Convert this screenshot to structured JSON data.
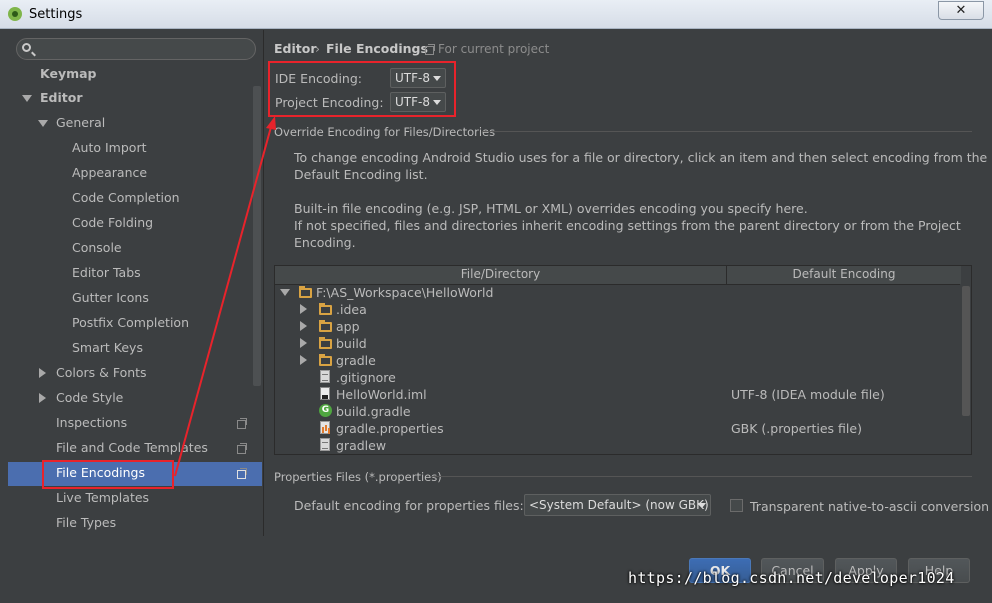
{
  "window": {
    "title": "Settings",
    "close_symbol": "✕"
  },
  "search": {
    "placeholder": ""
  },
  "sidebar": {
    "items": [
      {
        "label": "Keymap"
      },
      {
        "label": "Editor"
      },
      {
        "label": "General"
      },
      {
        "label": "Auto Import"
      },
      {
        "label": "Appearance"
      },
      {
        "label": "Code Completion"
      },
      {
        "label": "Code Folding"
      },
      {
        "label": "Console"
      },
      {
        "label": "Editor Tabs"
      },
      {
        "label": "Gutter Icons"
      },
      {
        "label": "Postfix Completion"
      },
      {
        "label": "Smart Keys"
      },
      {
        "label": "Colors & Fonts"
      },
      {
        "label": "Code Style"
      },
      {
        "label": "Inspections"
      },
      {
        "label": "File and Code Templates"
      },
      {
        "label": "File Encodings"
      },
      {
        "label": "Live Templates"
      },
      {
        "label": "File Types"
      }
    ],
    "selected": "File Encodings"
  },
  "header": {
    "crumb1": "Editor",
    "crumb_sep": "›",
    "crumb2": "File Encodings",
    "scope": "For current project"
  },
  "encoding": {
    "ide_label": "IDE Encoding:",
    "ide_value": "UTF-8",
    "project_label": "Project Encoding:",
    "project_value": "UTF-8"
  },
  "override": {
    "section_title": "Override Encoding for Files/Directories",
    "desc1": "To change encoding Android Studio uses for a file or directory, click an item and then select encoding from the",
    "desc1b": "Default Encoding list.",
    "desc2": "Built-in file encoding (e.g. JSP, HTML or XML) overrides encoding you specify here.",
    "desc3": "If not specified, files and directories inherit encoding settings from the parent directory or from the Project",
    "desc3b": "Encoding."
  },
  "table": {
    "columns": [
      "File/Directory",
      "Default Encoding"
    ],
    "rows": [
      {
        "name": "F:\\AS_Workspace\\HelloWorld",
        "encoding": "",
        "icon": "folder-icon"
      },
      {
        "name": ".idea",
        "encoding": "",
        "icon": "folder-icon"
      },
      {
        "name": "app",
        "encoding": "",
        "icon": "folder-icon"
      },
      {
        "name": "build",
        "encoding": "",
        "icon": "folder-icon"
      },
      {
        "name": "gradle",
        "encoding": "",
        "icon": "folder-icon"
      },
      {
        "name": ".gitignore",
        "encoding": "",
        "icon": "text-file-icon"
      },
      {
        "name": "HelloWorld.iml",
        "encoding": "UTF-8 (IDEA module file)",
        "icon": "module-file-icon"
      },
      {
        "name": "build.gradle",
        "encoding": "",
        "icon": "gradle-icon"
      },
      {
        "name": "gradle.properties",
        "encoding": "GBK (.properties file)",
        "icon": "properties-file-icon"
      },
      {
        "name": "gradlew",
        "encoding": "",
        "icon": "text-file-icon"
      }
    ]
  },
  "properties": {
    "section_title": "Properties Files (*.properties)",
    "default_label": "Default encoding for properties files:",
    "default_value": "<System Default> (now GBK)",
    "native_label": "Transparent native-to-ascii conversion",
    "native_checked": false
  },
  "buttons": {
    "ok": "OK",
    "cancel": "Cancel",
    "apply": "Apply",
    "help": "Help"
  },
  "watermark": "https://blog.csdn.net/developer1024",
  "colors": {
    "annotation": "#e8232b",
    "selection": "#4b6eaf",
    "background": "#3c3f41"
  }
}
